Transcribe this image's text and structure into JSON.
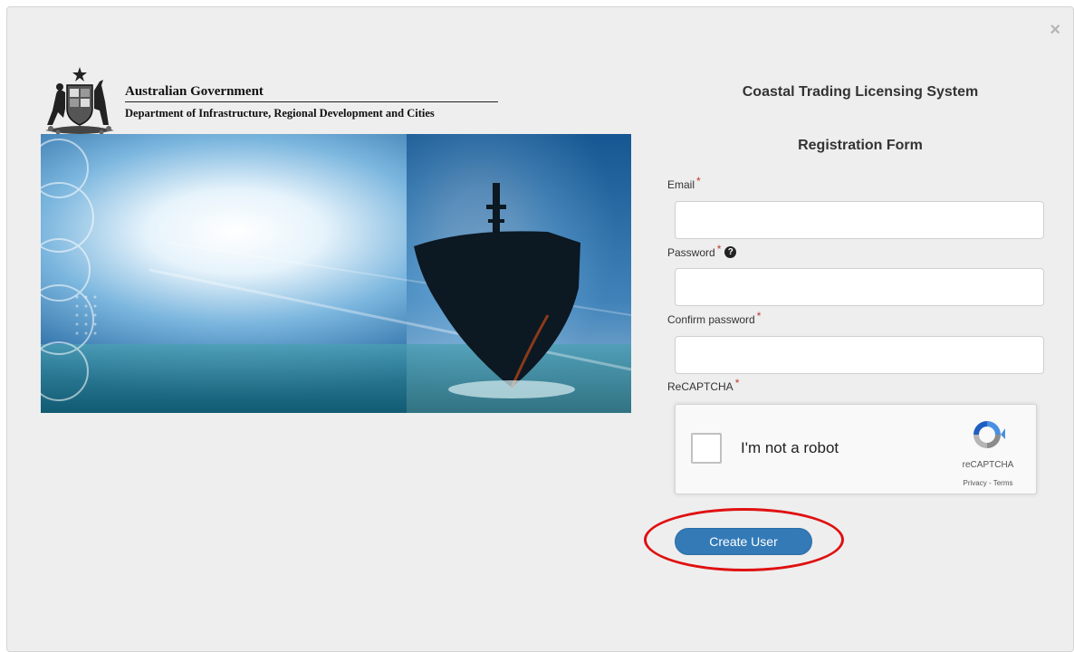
{
  "modal": {
    "close_symbol": "×"
  },
  "government": {
    "name": "Australian Government",
    "department": "Department of Infrastructure, Regional Development and Cities",
    "crest_icon": "coat-of-arms-icon"
  },
  "hero": {
    "image_icon": "ship-ocean-banner-image"
  },
  "form": {
    "system_title": "Coastal Trading Licensing System",
    "form_title": "Registration Form",
    "required_marker": "*",
    "email": {
      "label": "Email",
      "value": "",
      "placeholder": ""
    },
    "password": {
      "label": "Password",
      "value": "",
      "placeholder": "",
      "help_symbol": "?"
    },
    "confirm_password": {
      "label": "Confirm password",
      "value": "",
      "placeholder": ""
    },
    "recaptcha": {
      "label": "ReCAPTCHA",
      "checkbox_text": "I'm not a robot",
      "brand": "reCAPTCHA",
      "links": "Privacy - Terms",
      "checked": false
    },
    "submit_label": "Create User"
  },
  "colors": {
    "background": "#eeeeee",
    "primary_button": "#337ab7",
    "required": "#c0392b",
    "highlight": "#e01010"
  }
}
